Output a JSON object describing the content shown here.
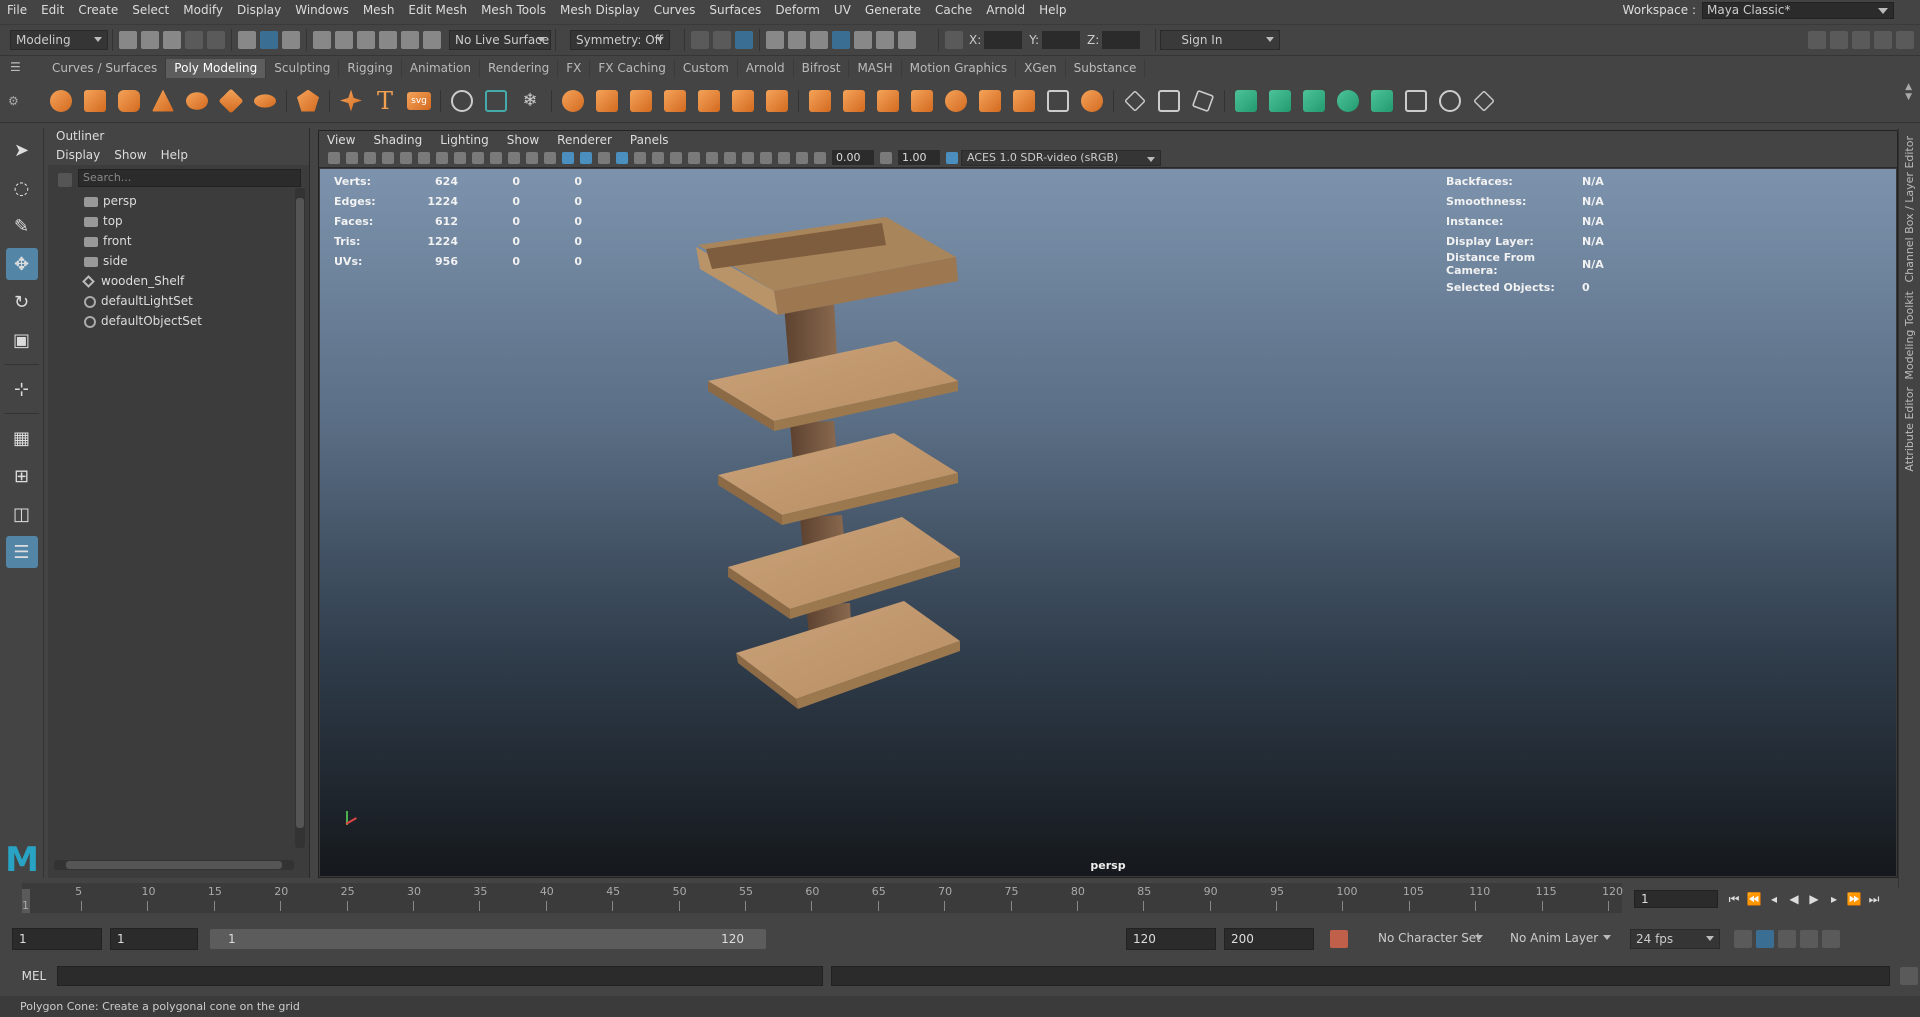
{
  "menu": [
    "File",
    "Edit",
    "Create",
    "Select",
    "Modify",
    "Display",
    "Windows",
    "Mesh",
    "Edit Mesh",
    "Mesh Tools",
    "Mesh Display",
    "Curves",
    "Surfaces",
    "Deform",
    "UV",
    "Generate",
    "Cache",
    "Arnold",
    "Help"
  ],
  "workspace": {
    "label": "Workspace :",
    "value": "Maya Classic*"
  },
  "status": {
    "mode": "Modeling",
    "live_surface": "No Live Surface",
    "symmetry": "Symmetry: Off",
    "x": "X:",
    "y": "Y:",
    "z": "Z:",
    "sign_in": "Sign In"
  },
  "shelf_tabs": [
    "Curves / Surfaces",
    "Poly Modeling",
    "Sculpting",
    "Rigging",
    "Animation",
    "Rendering",
    "FX",
    "FX Caching",
    "Custom",
    "Arnold",
    "Bifrost",
    "MASH",
    "Motion Graphics",
    "XGen",
    "Substance"
  ],
  "active_tab": "Poly Modeling",
  "outliner": {
    "title": "Outliner",
    "menu": [
      "Display",
      "Show",
      "Help"
    ],
    "search_placeholder": "Search...",
    "items": [
      {
        "label": "persp",
        "icon": "camera-icon"
      },
      {
        "label": "top",
        "icon": "camera-icon"
      },
      {
        "label": "front",
        "icon": "camera-icon"
      },
      {
        "label": "side",
        "icon": "camera-icon"
      },
      {
        "label": "wooden_Shelf",
        "icon": "group-icon"
      },
      {
        "label": "defaultLightSet",
        "icon": "set-icon"
      },
      {
        "label": "defaultObjectSet",
        "icon": "set-icon"
      }
    ]
  },
  "viewport": {
    "menu": [
      "View",
      "Shading",
      "Lighting",
      "Show",
      "Renderer",
      "Panels"
    ],
    "exposure": "0.00",
    "gamma": "1.00",
    "colorspace": "ACES 1.0 SDR-video (sRGB)",
    "camera": "persp",
    "stats": [
      [
        "Verts:",
        "624",
        "0",
        "0"
      ],
      [
        "Edges:",
        "1224",
        "0",
        "0"
      ],
      [
        "Faces:",
        "612",
        "0",
        "0"
      ],
      [
        "Tris:",
        "1224",
        "0",
        "0"
      ],
      [
        "UVs:",
        "956",
        "0",
        "0"
      ]
    ],
    "info": [
      [
        "Backfaces:",
        "N/A"
      ],
      [
        "Smoothness:",
        "N/A"
      ],
      [
        "Instance:",
        "N/A"
      ],
      [
        "Display Layer:",
        "N/A"
      ],
      [
        "Distance From Camera:",
        "N/A"
      ],
      [
        "Selected Objects:",
        "0"
      ]
    ]
  },
  "right_tabs": [
    "Channel Box / Layer Editor",
    "Modeling Toolkit",
    "Attribute Editor"
  ],
  "timeline": {
    "ticks": [
      "5",
      "10",
      "15",
      "20",
      "25",
      "30",
      "35",
      "40",
      "45",
      "50",
      "55",
      "60",
      "65",
      "70",
      "75",
      "80",
      "85",
      "90",
      "95",
      "100",
      "105",
      "110",
      "115",
      "120"
    ],
    "start": "1",
    "current": "1"
  },
  "range": {
    "start": "1",
    "playstart": "1",
    "slider_start": "1",
    "slider_end": "120",
    "end": "120",
    "anim_end": "200",
    "char_set": "No Character Set",
    "anim_layer": "No Anim Layer",
    "fps": "24 fps"
  },
  "command": {
    "label": "MEL"
  },
  "help_line": "Polygon Cone: Create a polygonal cone on the grid"
}
